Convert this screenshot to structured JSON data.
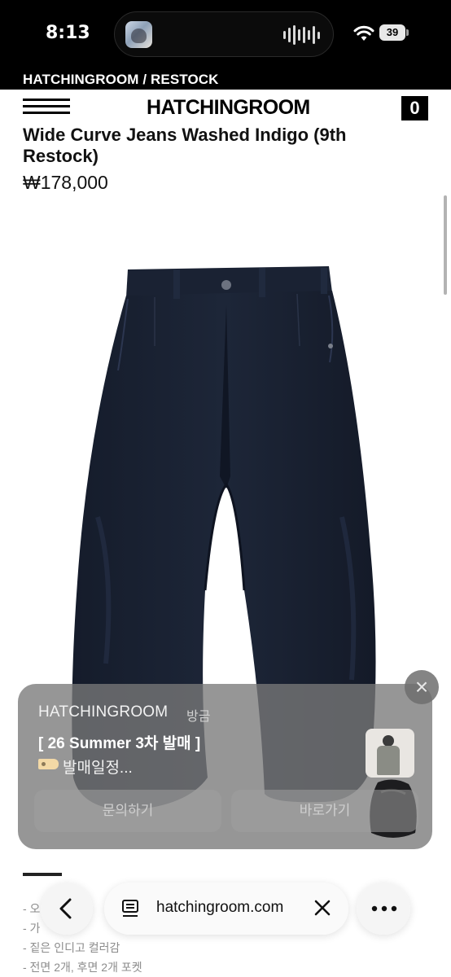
{
  "status_bar": {
    "time": "8:13",
    "battery": "39",
    "icons": [
      "island-thumbnail-icon",
      "audio-waveform-icon",
      "wifi-icon",
      "battery-icon"
    ]
  },
  "banner": {
    "breadcrumb": "HATCHINGROOM / RESTOCK"
  },
  "header": {
    "menu_icon": "hamburger-icon",
    "logo": "HATCHINGROOM",
    "cart_count": "0"
  },
  "product": {
    "title": "Wide Curve Jeans Washed Indigo (9th Restock)",
    "price": "₩178,000",
    "image_alt": "Wide curve jeans, dark indigo denim"
  },
  "notification": {
    "app": "HATCHINGROOM",
    "time": "방금",
    "title": "[ 26 Summer 3차 발매 ]",
    "body": "발매일정...",
    "tag_icon": "tag-icon",
    "buttons": [
      "문의하기",
      "바로가기"
    ],
    "close_icon": "close-icon"
  },
  "description": {
    "lines": [
      "- 오",
      "- 가",
      "- 짙은 인디고 컬러감",
      "- 전면 2개, 후면 2개 포켓"
    ]
  },
  "browser": {
    "url": "hatchingroom.com",
    "icons": [
      "back-chevron-icon",
      "reader-icon",
      "close-icon",
      "more-icon"
    ]
  }
}
